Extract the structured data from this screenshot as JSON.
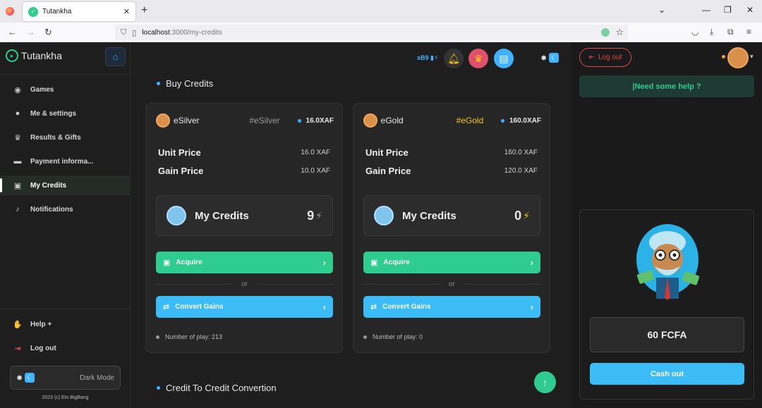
{
  "browser": {
    "tab_title": "Tutankha",
    "url_host": "localhost",
    "url_path": ":3000/my-credits"
  },
  "sidebar": {
    "brand": "Tutankha",
    "items": [
      {
        "label": "Games",
        "icon": "gamepad-icon"
      },
      {
        "label": "Me & settings",
        "icon": "user-icon"
      },
      {
        "label": "Results & Gifts",
        "icon": "trophy-icon"
      },
      {
        "label": "Payment informa...",
        "icon": "card-icon"
      },
      {
        "label": "My Credits",
        "icon": "credits-icon"
      },
      {
        "label": "Notifications",
        "icon": "bell-icon"
      }
    ],
    "help_label": "Help +",
    "logout_label": "Log out",
    "dark_mode_label": "Dark Mode",
    "copyright": "2023 (c) Ets BigBang"
  },
  "header": {
    "badge": "xB9"
  },
  "sections": {
    "buy_credits": "Buy Credits",
    "conversion": "Credit To Credit Convertion"
  },
  "cards": [
    {
      "name": "eSilver",
      "tag": "#eSilver",
      "tag_color": "#9a9a9a",
      "price": "16.0XAF",
      "unit_price_label": "Unit Price",
      "unit_price": "16.0 XAF",
      "gain_price_label": "Gain Price",
      "gain_price": "10.0 XAF",
      "my_credits_label": "My Credits",
      "my_credits": "9",
      "acquire_label": "Acquire",
      "or_label": "or",
      "convert_label": "Convert Gains",
      "plays": "Number of play: 213"
    },
    {
      "name": "eGold",
      "tag": "#eGold",
      "tag_color": "#f5c518",
      "price": "160.0XAF",
      "unit_price_label": "Unit Price",
      "unit_price": "160.0 XAF",
      "gain_price_label": "Gain Price",
      "gain_price": "120.0 XAF",
      "my_credits_label": "My Credits",
      "my_credits": "0",
      "acquire_label": "Acquire",
      "or_label": "or",
      "convert_label": "Convert Gains",
      "plays": "Number of play: 0"
    }
  ],
  "right_panel": {
    "logout_label": "Log out",
    "help_label": "|Need some help ?",
    "amount": "60 FCFA",
    "cashout_label": "Cash out"
  },
  "colors": {
    "accent_green": "#2ecc8f",
    "accent_blue": "#3bbcf6",
    "danger": "#e04a4a"
  }
}
